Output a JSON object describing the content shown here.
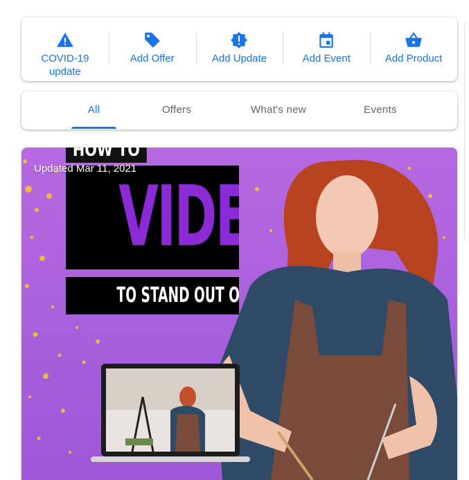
{
  "actions": [
    {
      "label": "COVID-19 update",
      "icon": "warning-triangle-icon"
    },
    {
      "label": "Add Offer",
      "icon": "tag-icon"
    },
    {
      "label": "Add Update",
      "icon": "alert-badge-icon"
    },
    {
      "label": "Add Event",
      "icon": "calendar-icon"
    },
    {
      "label": "Add Product",
      "icon": "basket-icon"
    }
  ],
  "tabs": [
    {
      "label": "All",
      "active": true
    },
    {
      "label": "Offers",
      "active": false
    },
    {
      "label": "What's new",
      "active": false
    },
    {
      "label": "Events",
      "active": false
    }
  ],
  "post": {
    "updated": "Updated Mar 11, 2021",
    "headline_top": "HOW TO USE",
    "headline_main": "VIDEO",
    "headline_sub": "TO STAND OUT ONLINE",
    "image": "woman-in-apron-crafting-photo"
  },
  "colors": {
    "accent": "#1a73e8",
    "tab_inactive": "#5f6368",
    "image_background": "#a45ad6",
    "headline_purple": "#8a2bd6"
  }
}
